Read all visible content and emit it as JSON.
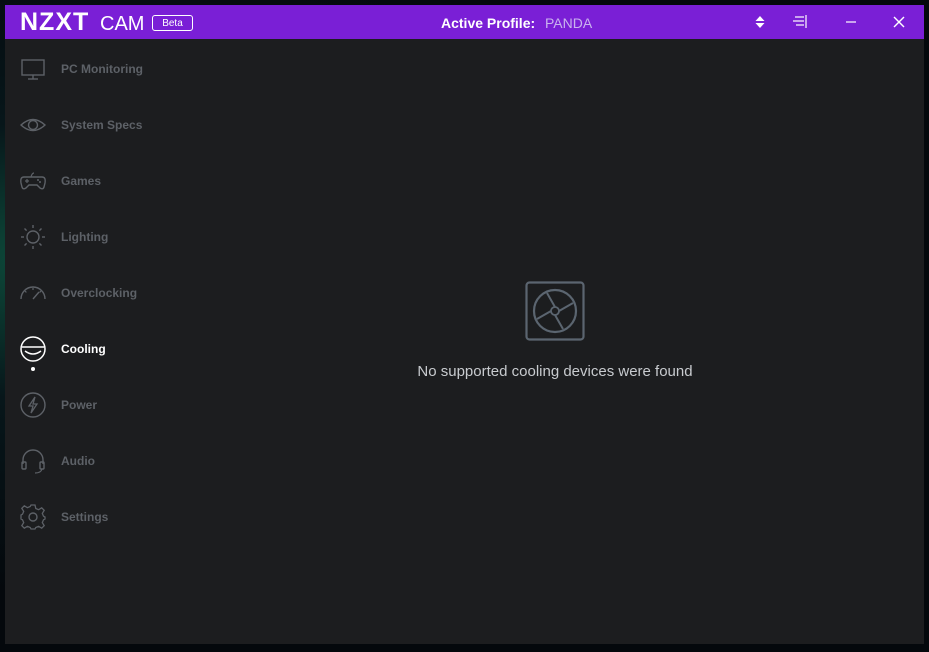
{
  "app": {
    "brand": "NZXT",
    "product": "CAM",
    "badge": "Beta"
  },
  "header": {
    "profile_label": "Active Profile:",
    "profile_value": "PANDA"
  },
  "sidebar": {
    "items": [
      {
        "label": "PC Monitoring",
        "icon": "monitor-icon"
      },
      {
        "label": "System Specs",
        "icon": "eye-icon"
      },
      {
        "label": "Games",
        "icon": "gamepad-icon"
      },
      {
        "label": "Lighting",
        "icon": "sun-icon"
      },
      {
        "label": "Overclocking",
        "icon": "gauge-icon"
      },
      {
        "label": "Cooling",
        "icon": "cooling-icon",
        "active": true
      },
      {
        "label": "Power",
        "icon": "lightning-icon"
      },
      {
        "label": "Audio",
        "icon": "headset-icon"
      },
      {
        "label": "Settings",
        "icon": "gear-icon"
      }
    ]
  },
  "main": {
    "empty_message": "No supported cooling devices were found",
    "empty_icon": "fan-icon"
  },
  "colors": {
    "titlebar": "#7a1fd6",
    "window_bg": "#1c1d1f",
    "inactive_text": "#5d6167",
    "active_text": "#ffffff"
  }
}
